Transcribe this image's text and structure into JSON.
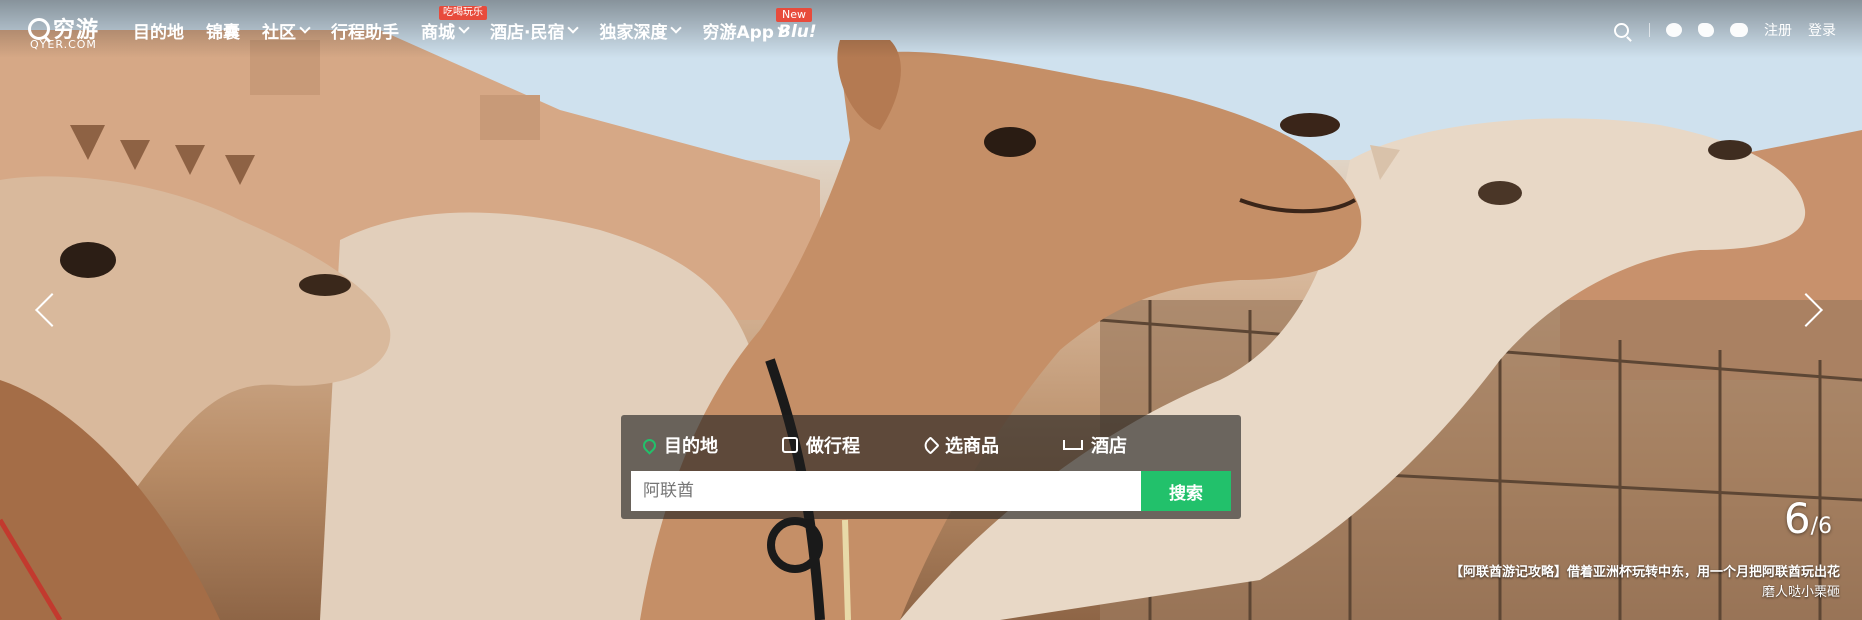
{
  "brand": {
    "name": "穷游",
    "sub": "QYER.COM"
  },
  "nav": {
    "items": [
      {
        "label": "目的地"
      },
      {
        "label": "锦囊"
      },
      {
        "label": "社区"
      },
      {
        "label": "行程助手"
      },
      {
        "label": "商城",
        "badge": "吃喝玩乐"
      },
      {
        "label": "酒店·民宿"
      },
      {
        "label": "独家深度"
      },
      {
        "label": "穷游App"
      }
    ],
    "new_badge": "New",
    "blu_label": "Blu!",
    "register": "注册",
    "login": "登录"
  },
  "search_panel": {
    "tabs": [
      "目的地",
      "做行程",
      "选商品",
      "酒店"
    ],
    "input_value": "阿联酋",
    "button_label": "搜索"
  },
  "slide": {
    "current": "6",
    "total": "/6",
    "title": "【阿联酋游记攻略】借着亚洲杯玩转中东，用一个月把阿联酋玩出花",
    "author": "磨人哒小栗砸"
  },
  "colors": {
    "accent": "#22c16b",
    "badge": "#e84b3c"
  },
  "icons": [
    "search-icon",
    "qq-icon",
    "weibo-icon",
    "wechat-icon",
    "arrow-left-icon",
    "arrow-right-icon",
    "location-pin-icon",
    "bag-icon",
    "tag-icon",
    "bed-icon"
  ]
}
